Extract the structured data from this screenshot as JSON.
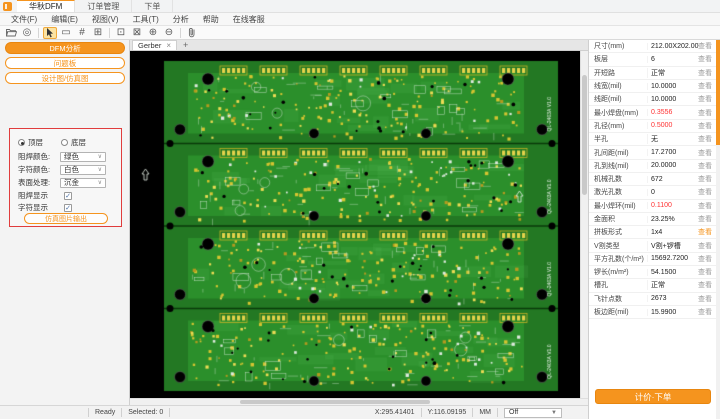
{
  "titlebar": {
    "tabs": [
      {
        "label": "华秋DFM",
        "active": true
      },
      {
        "label": "订单管理",
        "active": false
      },
      {
        "label": "下单",
        "active": false
      }
    ]
  },
  "menubar": {
    "items": [
      "文件(F)",
      "编辑(E)",
      "视图(V)",
      "工具(T)",
      "分析",
      "帮助",
      "在线客服"
    ]
  },
  "toolbar": {
    "icons": [
      {
        "name": "open-folder-icon",
        "svg": "folder"
      },
      {
        "name": "preview-icon",
        "glyph": "◎"
      },
      {
        "name": "cursor-icon",
        "svg": "cursor",
        "active": true,
        "sep_before": true
      },
      {
        "name": "rect-select-icon",
        "glyph": "▭"
      },
      {
        "name": "measure-icon",
        "glyph": "#"
      },
      {
        "name": "panel-grid-icon",
        "glyph": "⊞"
      },
      {
        "name": "crop-icon",
        "glyph": "⊡",
        "sep_before": true
      },
      {
        "name": "fit-view-icon",
        "glyph": "⊠"
      },
      {
        "name": "zoom-in-icon",
        "glyph": "⊕"
      },
      {
        "name": "zoom-out-icon",
        "glyph": "⊖"
      },
      {
        "name": "attach-icon",
        "svg": "clip",
        "sep_before": true
      }
    ]
  },
  "left_panel": {
    "dfm_button": "DFM分析",
    "issues_button": "问题板",
    "view_toggle_button": "设计图/仿真图",
    "layer_radios": [
      {
        "label": "顶层",
        "selected": true
      },
      {
        "label": "底层",
        "selected": false
      }
    ],
    "settings": [
      {
        "label": "阻焊颜色:",
        "value": "绿色"
      },
      {
        "label": "字符颜色:",
        "value": "白色"
      },
      {
        "label": "表面处理:",
        "value": "沉金"
      }
    ],
    "toggles": [
      {
        "label": "阻焊显示",
        "checked": true
      },
      {
        "label": "字符显示",
        "checked": true
      }
    ],
    "export_button": "仿真图片输出"
  },
  "canvas": {
    "tab_label": "Gerber",
    "close_glyph": "×",
    "add_glyph": "+",
    "board_label": "QL-2403A V1.0"
  },
  "right_panel": {
    "link_label": "查看",
    "rows": [
      {
        "label": "尺寸(mm)",
        "value": "212.00X202.00",
        "alert": false,
        "link_orange": false
      },
      {
        "label": "板层",
        "value": "6",
        "alert": false,
        "link_orange": false
      },
      {
        "label": "开短路",
        "value": "正常",
        "alert": false,
        "link_orange": false
      },
      {
        "label": "线宽(mil)",
        "value": "10.0000",
        "alert": false,
        "link_orange": false
      },
      {
        "label": "线距(mil)",
        "value": "10.0000",
        "alert": false,
        "link_orange": false
      },
      {
        "label": "最小焊盘(mm)",
        "value": "0.3556",
        "alert": true,
        "link_orange": false
      },
      {
        "label": "孔径(mm)",
        "value": "0.5000",
        "alert": true,
        "link_orange": false
      },
      {
        "label": "半孔",
        "value": "无",
        "alert": false,
        "link_orange": false
      },
      {
        "label": "孔间距(mil)",
        "value": "17.2700",
        "alert": false,
        "link_orange": false
      },
      {
        "label": "孔到线(mil)",
        "value": "20.0000",
        "alert": false,
        "link_orange": false
      },
      {
        "label": "机械孔数",
        "value": "672",
        "alert": false,
        "link_orange": false
      },
      {
        "label": "激光孔数",
        "value": "0",
        "alert": false,
        "link_orange": false
      },
      {
        "label": "最小焊环(mil)",
        "value": "0.1100",
        "alert": true,
        "link_orange": false
      },
      {
        "label": "金面积",
        "value": "23.25%",
        "alert": false,
        "link_orange": false
      },
      {
        "label": "拼板形式",
        "value": "1x4",
        "alert": false,
        "link_orange": true
      },
      {
        "label": "V割类型",
        "value": "V割+锣槽",
        "alert": false,
        "link_orange": false
      },
      {
        "label": "平方孔数(个/m²)",
        "value": "15692.7200",
        "alert": false,
        "link_orange": false
      },
      {
        "label": "锣长(m/m²)",
        "value": "54.1500",
        "alert": false,
        "link_orange": false
      },
      {
        "label": "槽孔",
        "value": "正常",
        "alert": false,
        "link_orange": false
      },
      {
        "label": "飞针点数",
        "value": "2673",
        "alert": false,
        "link_orange": false
      },
      {
        "label": "板边距(mil)",
        "value": "15.9900",
        "alert": false,
        "link_orange": false
      }
    ],
    "order_button": "计价·下单"
  },
  "statusbar": {
    "ready": "Ready",
    "selected": "Selected: 0",
    "x": "X:295.41401",
    "y": "Y:116.09195",
    "unit": "MM",
    "mode": "Off"
  },
  "colors": {
    "accent": "#f5941e",
    "alert": "#ff3232",
    "link": "#9b9b9b",
    "board_green": "#237823",
    "pad_gold": "#d6c531"
  }
}
